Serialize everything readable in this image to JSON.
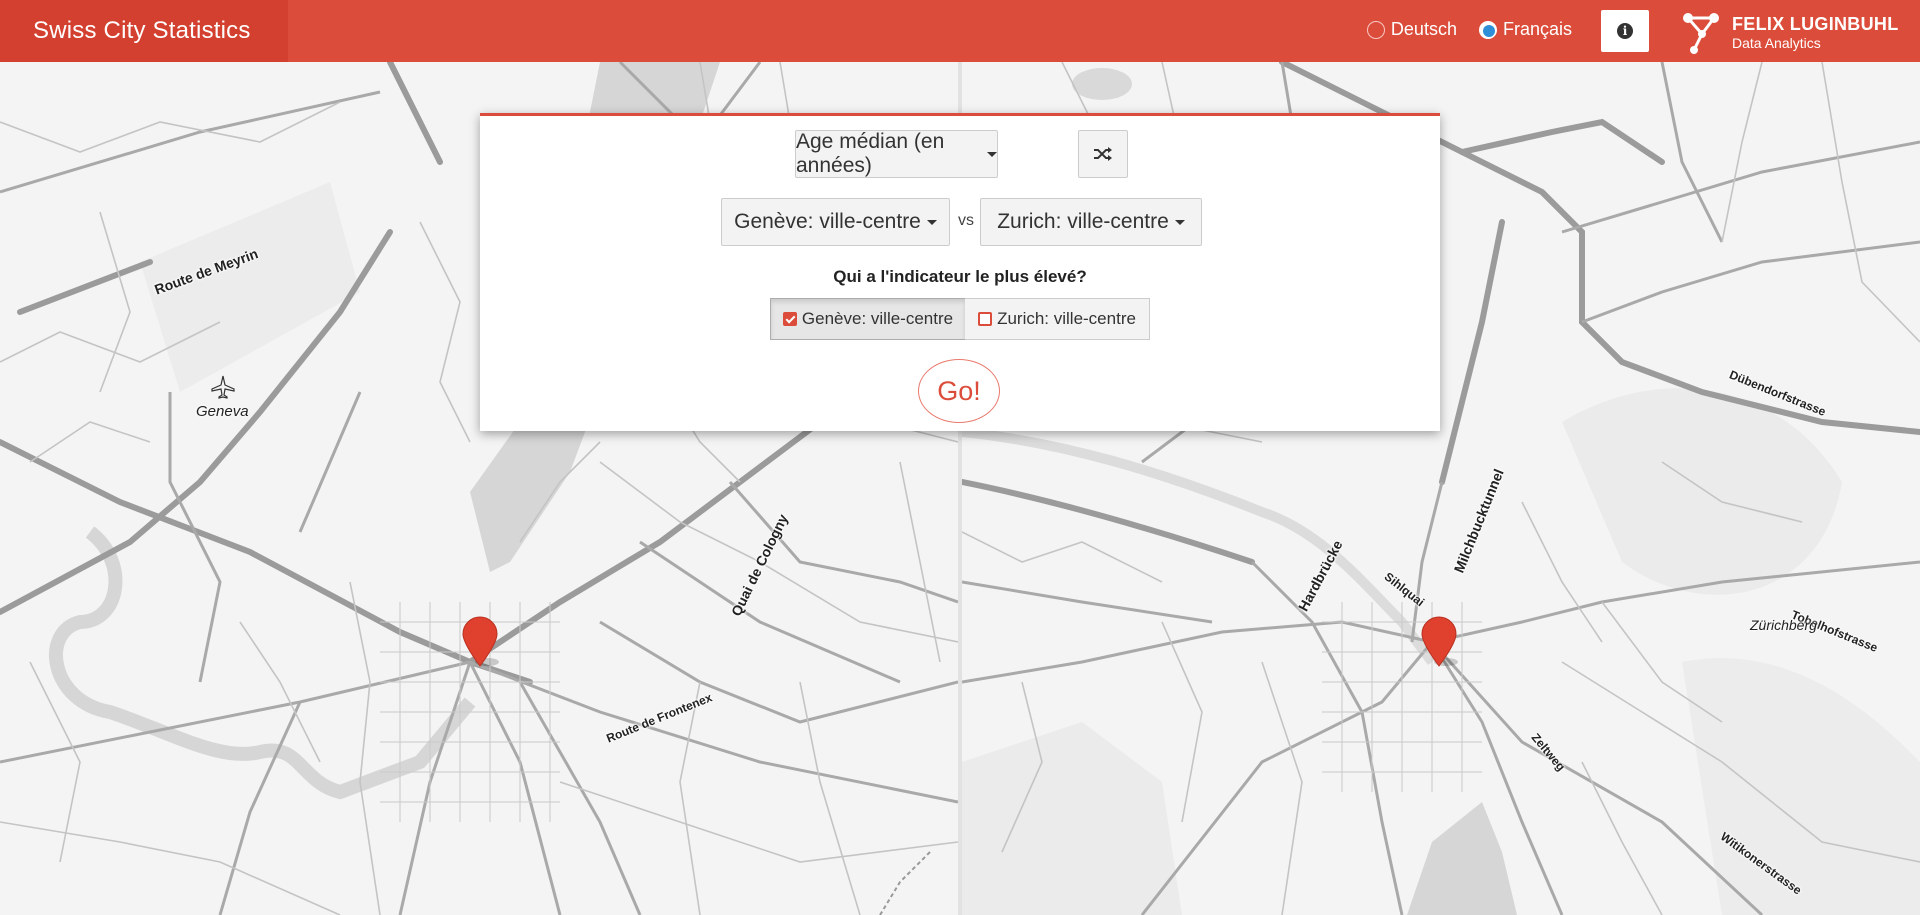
{
  "header": {
    "title": "Swiss City Statistics",
    "languages": [
      {
        "label": "Deutsch",
        "selected": false
      },
      {
        "label": "Français",
        "selected": true
      }
    ],
    "info_icon": "info-circle-icon",
    "logo": {
      "name": "FELIX LUGINBUHL",
      "subtitle": "Data Analytics"
    }
  },
  "panel": {
    "indicator": "Age médian (en années)",
    "shuffle_icon": "shuffle-icon",
    "city_a": "Genève: ville-centre",
    "vs": "vs",
    "city_b": "Zurich: ville-centre",
    "question": "Qui a l'indicateur le plus élevé?",
    "answer_a": "Genève: ville-centre",
    "answer_b": "Zurich: ville-centre",
    "answer_a_checked": true,
    "answer_b_checked": false,
    "go": "Go!"
  },
  "map_left": {
    "labels": {
      "route_meyrin": "Route de Meyrin",
      "geneva": "Geneva",
      "quai_cologny": "Quai de Cologny",
      "route_frontenex": "Route de Frontenex"
    }
  },
  "map_right": {
    "labels": {
      "dubendorf": "Dübendorfstrasse",
      "milchbuck": "Milchbucktunnel",
      "hardbrucke": "Hardbrücke",
      "sihlquai": "Sihlquai",
      "tobelhof": "Tobelhofstrasse",
      "zurichberg": "Zürichberg",
      "zeltweg": "Zeltweg",
      "witikoner": "Witikonerstrasse"
    }
  },
  "colors": {
    "accent": "#dc4c3a",
    "radio_selected": "#2e8fd6",
    "marker": "#e0412e"
  }
}
